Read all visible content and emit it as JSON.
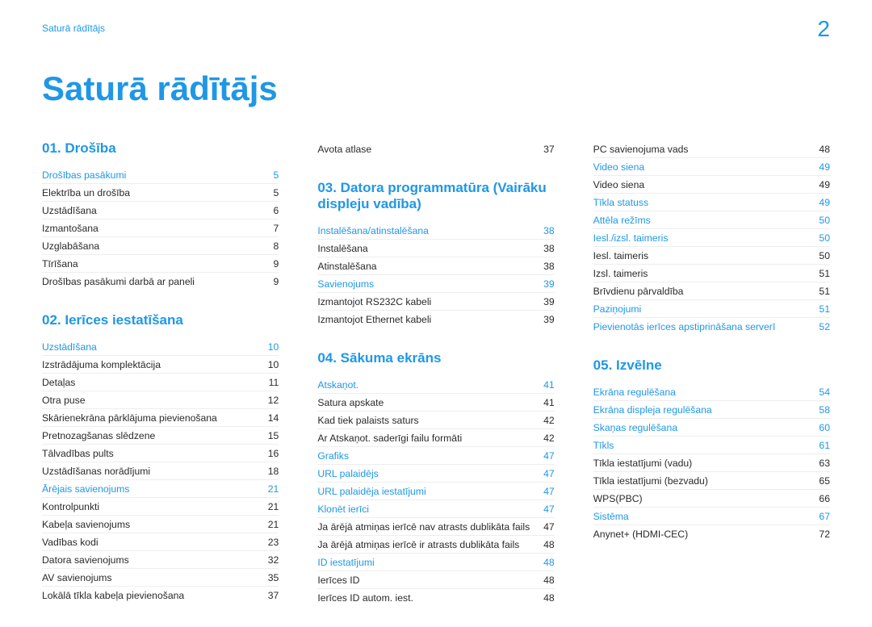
{
  "header": {
    "label": "Saturā rādītājs",
    "page_num": "2"
  },
  "title": "Saturā rādītājs",
  "columns": [
    [
      {
        "heading": "01.  Drošība",
        "mt": false,
        "rows": [
          {
            "t": "Drošības pasākumi",
            "p": "5",
            "link": true
          },
          {
            "t": "Elektrība un drošība",
            "p": "5"
          },
          {
            "t": "Uzstādīšana",
            "p": "6"
          },
          {
            "t": "Izmantošana",
            "p": "7"
          },
          {
            "t": "Uzglabāšana",
            "p": "8"
          },
          {
            "t": "Tīrīšana",
            "p": "9"
          },
          {
            "t": "Drošības pasākumi darbā ar paneli",
            "p": "9"
          }
        ]
      },
      {
        "heading": "02.  Ierīces iestatīšana",
        "mt": true,
        "rows": [
          {
            "t": "Uzstādīšana",
            "p": "10",
            "link": true
          },
          {
            "t": "Izstrādājuma komplektācija",
            "p": "10"
          },
          {
            "t": "Detaļas",
            "p": "11"
          },
          {
            "t": "Otra puse",
            "p": "12"
          },
          {
            "t": "Skārienekrāna pārklājuma pievienošana",
            "p": "14"
          },
          {
            "t": "Pretnozagšanas slēdzene",
            "p": "15"
          },
          {
            "t": "Tālvadības pults",
            "p": "16"
          },
          {
            "t": "Uzstādīšanas norādījumi",
            "p": "18"
          },
          {
            "t": "Ārējais savienojums",
            "p": "21",
            "link": true
          },
          {
            "t": "Kontrolpunkti",
            "p": "21"
          },
          {
            "t": "Kabeļa savienojums",
            "p": "21"
          },
          {
            "t": "Vadības kodi",
            "p": "23"
          },
          {
            "t": "Datora savienojums",
            "p": "32"
          },
          {
            "t": "AV savienojums",
            "p": "35"
          },
          {
            "t": "Lokālā tīkla kabeļa pievienošana",
            "p": "37"
          }
        ]
      }
    ],
    [
      {
        "heading": null,
        "mt": false,
        "rows": [
          {
            "t": "Avota atlase",
            "p": "37"
          }
        ]
      },
      {
        "heading": "03.  Datora programmatūra (Vairāku displeju vadība)",
        "mt": true,
        "rows": [
          {
            "t": "Instalēšana/atinstalēšana",
            "p": "38",
            "link": true
          },
          {
            "t": "Instalēšana",
            "p": "38"
          },
          {
            "t": "Atinstalēšana",
            "p": "38"
          },
          {
            "t": "Savienojums",
            "p": "39",
            "link": true
          },
          {
            "t": "Izmantojot RS232C kabeli",
            "p": "39"
          },
          {
            "t": "Izmantojot Ethernet kabeli",
            "p": "39"
          }
        ]
      },
      {
        "heading": "04.  Sākuma ekrāns",
        "mt": true,
        "rows": [
          {
            "t": "Atskaņot.",
            "p": "41",
            "link": true
          },
          {
            "t": "Satura apskate",
            "p": "41"
          },
          {
            "t": "Kad tiek palaists saturs",
            "p": "42"
          },
          {
            "t": "Ar Atskaņot. saderīgi failu formāti",
            "p": "42"
          },
          {
            "t": "Grafiks",
            "p": "47",
            "link": true
          },
          {
            "t": "URL palaidējs",
            "p": "47",
            "link": true
          },
          {
            "t": "URL palaidēja iestatījumi",
            "p": "47",
            "link": true
          },
          {
            "t": "Klonēt ierīci",
            "p": "47",
            "link": true
          },
          {
            "t": "Ja ārējā atmiņas ierīcē nav atrasts dublikāta fails",
            "p": "47"
          },
          {
            "t": "Ja ārējā atmiņas ierīcē ir atrasts dublikāta fails",
            "p": "48"
          },
          {
            "t": "ID iestatījumi",
            "p": "48",
            "link": true
          },
          {
            "t": "Ierīces ID",
            "p": "48"
          },
          {
            "t": "Ierīces ID autom. iest.",
            "p": "48"
          }
        ]
      }
    ],
    [
      {
        "heading": null,
        "mt": false,
        "rows": [
          {
            "t": "PC savienojuma vads",
            "p": "48"
          },
          {
            "t": "Video siena",
            "p": "49",
            "link": true
          },
          {
            "t": "Video siena",
            "p": "49"
          },
          {
            "t": "Tīkla statuss",
            "p": "49",
            "link": true
          },
          {
            "t": "Attēla režīms",
            "p": "50",
            "link": true
          },
          {
            "t": "Iesl./izsl. taimeris",
            "p": "50",
            "link": true
          },
          {
            "t": "Iesl. taimeris",
            "p": "50"
          },
          {
            "t": "Izsl. taimeris",
            "p": "51"
          },
          {
            "t": "Brīvdienu pārvaldība",
            "p": "51"
          },
          {
            "t": "Paziņojumi",
            "p": "51",
            "link": true
          },
          {
            "t": "Pievienotās ierīces apstiprināšana serverī",
            "p": "52",
            "link": true
          }
        ]
      },
      {
        "heading": "05.  Izvēlne",
        "mt": true,
        "rows": [
          {
            "t": "Ekrāna regulēšana",
            "p": "54",
            "link": true
          },
          {
            "t": "Ekrāna displeja regulēšana",
            "p": "58",
            "link": true
          },
          {
            "t": "Skaņas regulēšana",
            "p": "60",
            "link": true
          },
          {
            "t": "Tīkls",
            "p": "61",
            "link": true
          },
          {
            "t": "Tīkla iestatījumi (vadu)",
            "p": "63"
          },
          {
            "t": "Tīkla iestatījumi (bezvadu)",
            "p": "65"
          },
          {
            "t": "WPS(PBC)",
            "p": "66"
          },
          {
            "t": "Sistēma",
            "p": "67",
            "link": true
          },
          {
            "t": "Anynet+ (HDMI-CEC)",
            "p": "72"
          }
        ]
      }
    ]
  ]
}
